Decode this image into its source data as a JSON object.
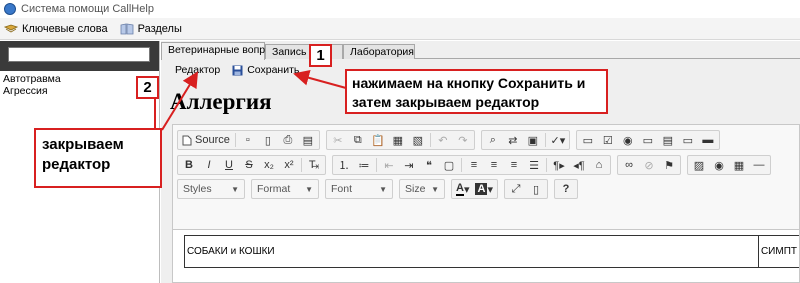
{
  "window": {
    "title": "Система помощи CallHelp"
  },
  "menu": {
    "keywords_label": "Ключевые слова",
    "sections_label": "Разделы"
  },
  "sidebar": {
    "search_value": "",
    "items": [
      {
        "label": "Автотравма"
      },
      {
        "label": "Агрессия"
      }
    ]
  },
  "tabs": [
    {
      "label": "Ветеринарные вопросы"
    },
    {
      "label": "Запись на"
    },
    {
      "label": "Лаборатория"
    }
  ],
  "editor_toolbar": {
    "editor_label": "Редактор",
    "save_label": "Сохранить"
  },
  "page": {
    "heading": "Аллергия"
  },
  "ckeditor": {
    "source_label": "Source",
    "styles_label": "Styles",
    "format_label": "Format",
    "font_label": "Font",
    "size_label": "Size",
    "help_label": "?"
  },
  "document": {
    "cell_1": "СОБАКИ и КОШКИ",
    "cell_2": "СИМПТ"
  },
  "annotations": {
    "badge_1": "1",
    "badge_2": "2",
    "callout_save": "нажимаем на кнопку Сохранить и затем закрываем редактор",
    "callout_close": "закрываем редактор"
  },
  "colors": {
    "annotation_red": "#d82020",
    "sidebar_header_dark": "#3a3a3a",
    "save_icon_blue": "#2a4f9a"
  }
}
